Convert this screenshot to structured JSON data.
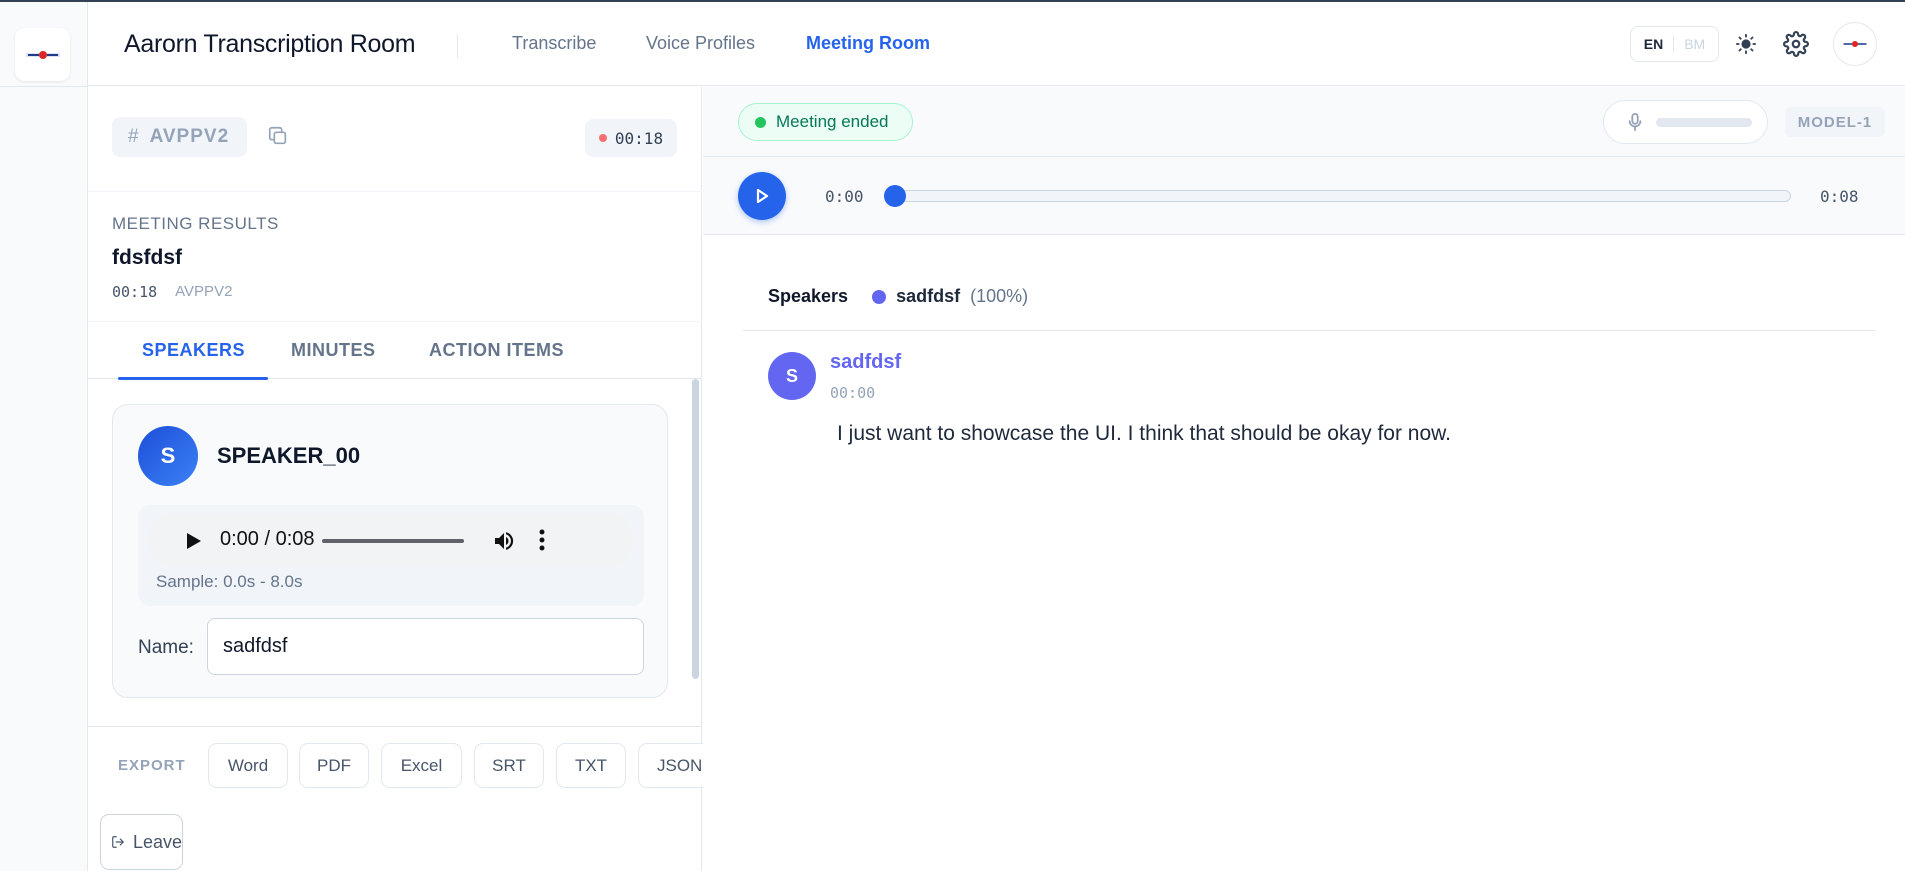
{
  "header": {
    "app_title": "Aarorn Transcription Room",
    "nav": [
      {
        "label": "Transcribe",
        "active": false
      },
      {
        "label": "Voice Profiles",
        "active": false
      },
      {
        "label": "Meeting Room",
        "active": true
      }
    ],
    "lang_active": "EN",
    "lang_other": "BM",
    "accent_color": "#2563eb"
  },
  "room": {
    "code": "AVPPV2",
    "hash_symbol": "#",
    "timer": "00:18"
  },
  "results": {
    "label": "MEETING RESULTS",
    "title": "fdsfdsf",
    "duration": "00:18",
    "code": "AVPPV2"
  },
  "tabs": [
    {
      "label": "SPEAKERS",
      "active": true
    },
    {
      "label": "MINUTES",
      "active": false
    },
    {
      "label": "ACTION ITEMS",
      "active": false
    }
  ],
  "speaker_card": {
    "avatar_letter": "S",
    "speaker_id": "SPEAKER_00",
    "audio_time": "0:00 / 0:08",
    "sample_text": "Sample: 0.0s - 8.0s",
    "name_label": "Name:",
    "name_value": "sadfdsf"
  },
  "export": {
    "label": "EXPORT",
    "buttons": [
      "Word",
      "PDF",
      "Excel",
      "SRT",
      "TXT",
      "JSON"
    ]
  },
  "leave_label": "Leave",
  "status": {
    "label": "Meeting ended",
    "color": "#22c55e"
  },
  "model_label": "MODEL-1",
  "player": {
    "current": "0:00",
    "total": "0:08",
    "progress": 0
  },
  "speakers_legend": {
    "label": "Speakers",
    "items": [
      {
        "name": "sadfdsf",
        "pct": "(100%)",
        "color": "#6366f1"
      }
    ]
  },
  "transcript": [
    {
      "avatar_letter": "S",
      "speaker": "sadfdsf",
      "time": "00:00",
      "text": "I just want to showcase the UI. I think that should be okay for now."
    }
  ]
}
